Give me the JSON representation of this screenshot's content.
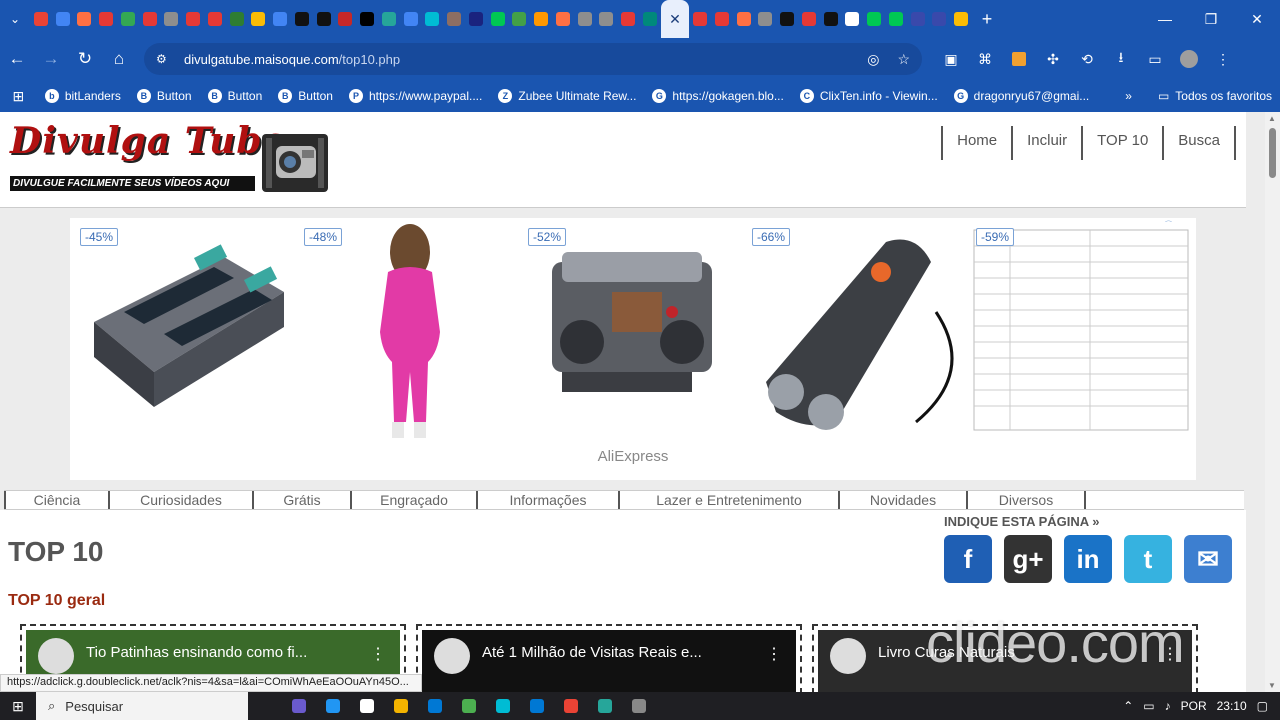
{
  "browser": {
    "active_tab_close": "✕",
    "new_tab": "+",
    "window": {
      "minimize": "—",
      "restore": "❐",
      "close": "✕"
    },
    "url_host": "divulgatube.maisoque.com",
    "url_path": "/top10.php",
    "tab_colors": [
      "#ea4335",
      "#4285f4",
      "#ff7043",
      "#e53935",
      "#34a853",
      "#e53935",
      "#8e8e8e",
      "#e53935",
      "#e53935",
      "#2e7d32",
      "#fbbc05",
      "#4285f4",
      "#111111",
      "#111111",
      "#c62828",
      "#000000",
      "#26a69a",
      "#4285f4",
      "#00bcd4",
      "#8d6e63",
      "#1a237e",
      "#00c853",
      "#43a047",
      "#ff9800",
      "#ff7043",
      "#8e8e8e",
      "#8e8e8e",
      "#e53935",
      "#00897b",
      "#e53935",
      "#e53935",
      "#ff7043",
      "#8e8e8e",
      "#111111",
      "#e53935",
      "#111111",
      "#ffffff",
      "#00c853",
      "#00c853",
      "#3949ab",
      "#3949ab",
      "#fbbc05"
    ],
    "bookmarks": [
      {
        "label": "bitLanders",
        "icon": "b"
      },
      {
        "label": "Button",
        "icon": "B"
      },
      {
        "label": "Button",
        "icon": "B"
      },
      {
        "label": "Button",
        "icon": "B"
      },
      {
        "label": "https://www.paypal....",
        "icon": "P"
      },
      {
        "label": "Zubee Ultimate Rew...",
        "icon": "Z"
      },
      {
        "label": "https://gokagen.blo...",
        "icon": "G"
      },
      {
        "label": "ClixTen.info - Viewin...",
        "icon": "C"
      },
      {
        "label": "dragonryu67@gmai...",
        "icon": "G"
      }
    ],
    "bookmarks_more": "»",
    "all_bookmarks": "Todos os favoritos"
  },
  "site": {
    "logo_title": "Divulga Tube",
    "logo_subtitle": "DIVULGUE FACILMENTE SEUS VÍDEOS AQUI",
    "topnav": [
      "Home",
      "Incluir",
      "TOP 10",
      "Busca"
    ],
    "ad": {
      "items": [
        {
          "discount": "-45%"
        },
        {
          "discount": "-48%"
        },
        {
          "discount": "-52%"
        },
        {
          "discount": "-66%"
        },
        {
          "discount": "-59%"
        }
      ],
      "brand": "AliExpress",
      "info": "ⓘ ⋮"
    },
    "categories": [
      "Ciência",
      "Curiosidades",
      "Grátis",
      "Engraçado",
      "Informações",
      "Lazer e Entretenimento",
      "Novidades",
      "Diversos"
    ],
    "page_title": "TOP 10",
    "section_title": "TOP 10 geral",
    "share_label": "INDIQUE ESTA PÁGINA »",
    "share_icons": [
      {
        "glyph": "f",
        "color": "#1f5fb4"
      },
      {
        "glyph": "g+",
        "color": "#333333"
      },
      {
        "glyph": "in",
        "color": "#1a73c7"
      },
      {
        "glyph": "t",
        "color": "#36b2e0"
      },
      {
        "glyph": "✉",
        "color": "#3d7fd0"
      }
    ],
    "videos": [
      {
        "title": "Tio Patinhas ensinando como fi...",
        "thumb_color": "#3a6a2a"
      },
      {
        "title": "Até 1 Milhão de Visitas Reais e...",
        "thumb_color": "#111111"
      },
      {
        "title": "Livro Curas Naturais",
        "thumb_color": "#2b2b2b"
      }
    ]
  },
  "status_url": "https://adclick.g.doubleclick.net/aclk?nis=4&sa=l&ai=COmiWhAeEaOOuAYn45O...",
  "watermark": "clideo.com",
  "taskbar": {
    "search_placeholder": "Pesquisar",
    "language": "POR",
    "time": "23:10",
    "app_colors": [
      "#6a5acd",
      "#2196f3",
      "#ffffff",
      "#f4b400",
      "#0078d4",
      "#4caf50",
      "#00bcd4",
      "#0078d4",
      "#ea4335",
      "#26a69a",
      "#888888"
    ]
  }
}
